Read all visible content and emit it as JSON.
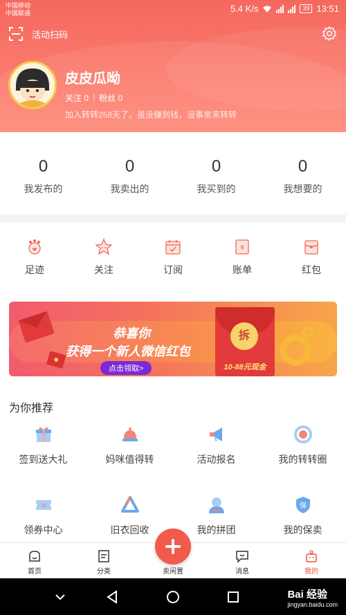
{
  "status_bar": {
    "carrier1": "中国移动",
    "carrier2": "中国联通",
    "speed": "5.4 K/s",
    "battery": "39",
    "time": "13:51"
  },
  "topbar": {
    "scan_label": "活动扫码"
  },
  "profile": {
    "username": "皮皮瓜呦",
    "follow_label": "关注 0",
    "fans_label": "粉丝 0",
    "bio": "加入转转258天了。虽没赚到钱，没事常来转转"
  },
  "stats": [
    {
      "value": "0",
      "label": "我发布的"
    },
    {
      "value": "0",
      "label": "我卖出的"
    },
    {
      "value": "0",
      "label": "我买到的"
    },
    {
      "value": "0",
      "label": "我想要的"
    }
  ],
  "shortcuts": [
    {
      "label": "足迹",
      "icon": "footprint-icon"
    },
    {
      "label": "关注",
      "icon": "star-icon"
    },
    {
      "label": "订阅",
      "icon": "calendar-icon"
    },
    {
      "label": "账单",
      "icon": "bill-icon"
    },
    {
      "label": "红包",
      "icon": "redpacket-icon"
    }
  ],
  "banner": {
    "line1": "恭喜你",
    "line2": "获得一个新人微信红包",
    "claim": "点击领取>",
    "coin": "拆",
    "cash": "10-88元现金"
  },
  "recommend": {
    "title": "为你推荐",
    "items": [
      {
        "label": "签到送大礼",
        "icon": "gift-icon"
      },
      {
        "label": "妈咪值得转",
        "icon": "bell-cake-icon"
      },
      {
        "label": "活动报名",
        "icon": "megaphone-icon"
      },
      {
        "label": "我的转转圈",
        "icon": "ring-icon"
      },
      {
        "label": "领券中心",
        "icon": "coupon-icon"
      },
      {
        "label": "旧衣回收",
        "icon": "recycle-icon"
      },
      {
        "label": "我的拼团",
        "icon": "group-icon"
      },
      {
        "label": "我的保卖",
        "icon": "shield-icon"
      }
    ]
  },
  "tabbar": {
    "items": [
      {
        "label": "首页"
      },
      {
        "label": "分类"
      },
      {
        "label": "卖闲置"
      },
      {
        "label": "消息"
      },
      {
        "label": "我的"
      }
    ]
  },
  "watermark": {
    "brand": "Bai 经验",
    "url": "jingyan.baidu.com"
  },
  "colors": {
    "accent": "#f25a4c",
    "header": "#f5685e"
  }
}
